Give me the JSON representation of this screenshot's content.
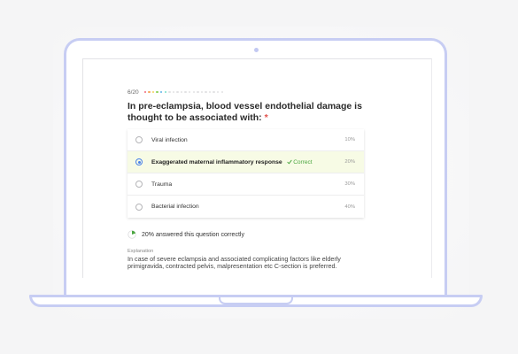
{
  "progress": {
    "count": "6/20",
    "answered": 6,
    "total": 20,
    "dot_colors": [
      "#f06b7a",
      "#f7a85e",
      "#f2d35a",
      "#8ed35e",
      "#5fb4e8",
      "#79dfc8"
    ]
  },
  "question": {
    "text": "In pre-eclampsia, blood vessel endothelial damage is thought to be associated with:",
    "required_mark": "*"
  },
  "options": [
    {
      "label": "Viral infection",
      "percent": "10%",
      "selected": false,
      "correct": false
    },
    {
      "label": "Exaggerated maternal inflammatory response",
      "percent": "20%",
      "selected": true,
      "correct": true,
      "correct_label": "Correct"
    },
    {
      "label": "Trauma",
      "percent": "30%",
      "selected": false,
      "correct": false
    },
    {
      "label": "Bacterial infection",
      "percent": "40%",
      "selected": false,
      "correct": false
    }
  ],
  "stats": {
    "text": "20% answered this question correctly",
    "fraction_correct": 0.2
  },
  "explanation": {
    "label": "Explanation",
    "text": "In case of severe eclampsia and associated complicating factors like elderly primigravida, contracted pelvis, malpresentation etc C-section is preferred."
  },
  "colors": {
    "accent": "#4a82e8",
    "correct": "#4aa640",
    "correct_bg": "#f7fbe5",
    "laptop_outline": "#c7cdf3",
    "required": "#e2514c"
  },
  "icons": {
    "check": "check-icon",
    "stats": "pie-chart-icon"
  }
}
